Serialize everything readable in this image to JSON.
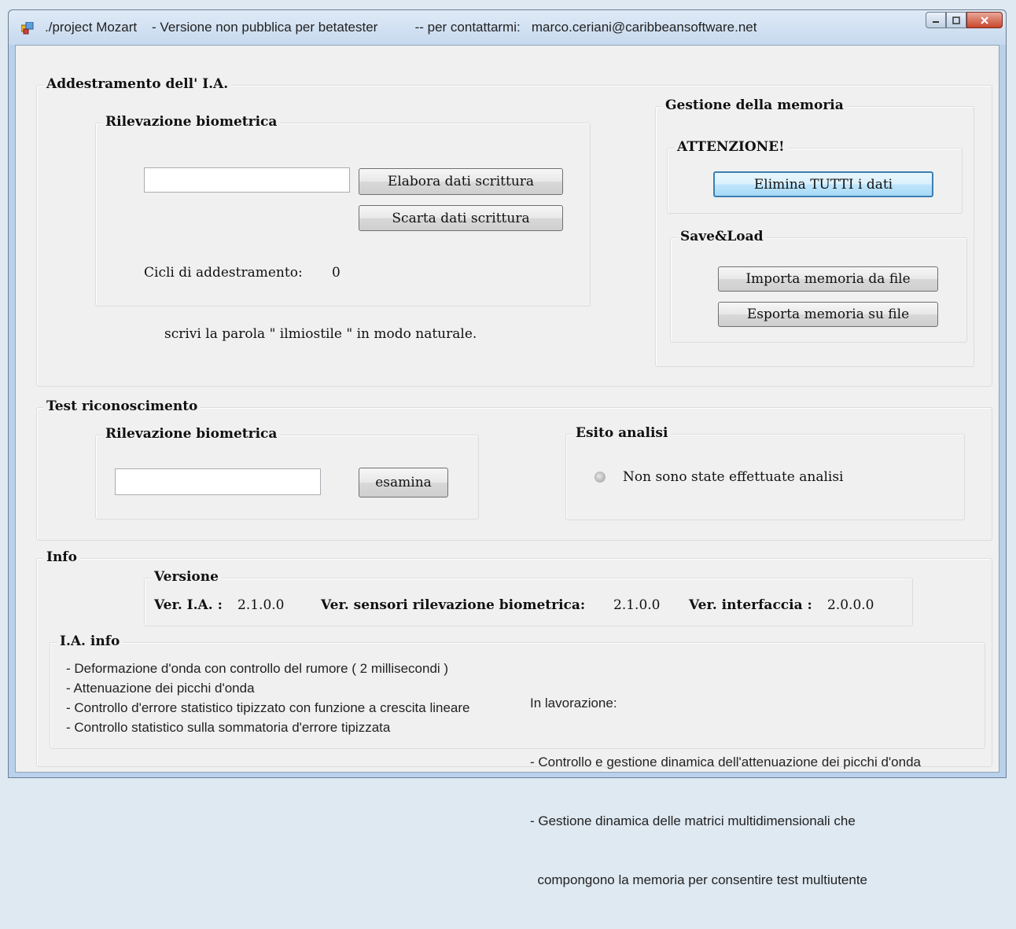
{
  "window": {
    "title": "./project Mozart    - Versione non pubblica per betatester          -- per contattarmi:   marco.ceriani@caribbeansoftware.net"
  },
  "addestramento": {
    "title": "Addestramento dell' I.A.",
    "rilevazione": {
      "title": "Rilevazione biometrica",
      "input_value": "",
      "elabora_label": "Elabora dati scrittura",
      "scarta_label": "Scarta dati scrittura",
      "cicli_label": "Cicli di addestramento:",
      "cicli_value": "0"
    },
    "hint": "scrivi la parola \" ilmiostile \" in modo naturale.",
    "memoria": {
      "title": "Gestione della memoria",
      "attenzione": {
        "title": "ATTENZIONE!",
        "elimina_label": "Elimina TUTTI i dati"
      },
      "saveload": {
        "title": "Save&Load",
        "importa_label": "Importa memoria da file",
        "esporta_label": "Esporta memoria su file"
      }
    }
  },
  "test": {
    "title": "Test riconoscimento",
    "rilevazione": {
      "title": "Rilevazione biometrica",
      "input_value": "",
      "esamina_label": "esamina"
    },
    "esito": {
      "title": "Esito analisi",
      "status": "Non sono state effettuate analisi"
    }
  },
  "info": {
    "title": "Info",
    "versione": {
      "title": "Versione",
      "ia_label": "Ver. I.A. :",
      "ia_value": "2.1.0.0",
      "sensori_label": "Ver. sensori rilevazione biometrica:",
      "sensori_value": "2.1.0.0",
      "interfaccia_label": "Ver. interfaccia :",
      "interfaccia_value": "2.0.0.0"
    },
    "ia_info": {
      "title": "I.A. info",
      "features": [
        "- Deformazione d'onda con controllo del rumore ( 2 millisecondi )",
        "- Attenuazione dei picchi d'onda",
        "- Controllo d'errore statistico tipizzato con funzione a crescita lineare",
        "- Controllo statistico sulla sommatoria d'errore tipizzata"
      ],
      "in_lavorazione": [
        "In lavorazione:",
        "- Controllo e gestione dinamica dell'attenuazione dei picchi d'onda",
        "- Gestione dinamica delle matrici multidimensionali che",
        "  compongono la memoria per consentire test multiutente"
      ]
    }
  },
  "icons": {
    "app": "app-icon",
    "minimize": "minimize-icon",
    "maximize": "maximize-icon",
    "close": "close-icon",
    "radio": "radio-indicator-icon"
  },
  "colors": {
    "titlebar": "#c6d9ee",
    "client": "#f0f0f0",
    "close_button": "#c9452a",
    "focus_border": "#3c7fb1"
  }
}
